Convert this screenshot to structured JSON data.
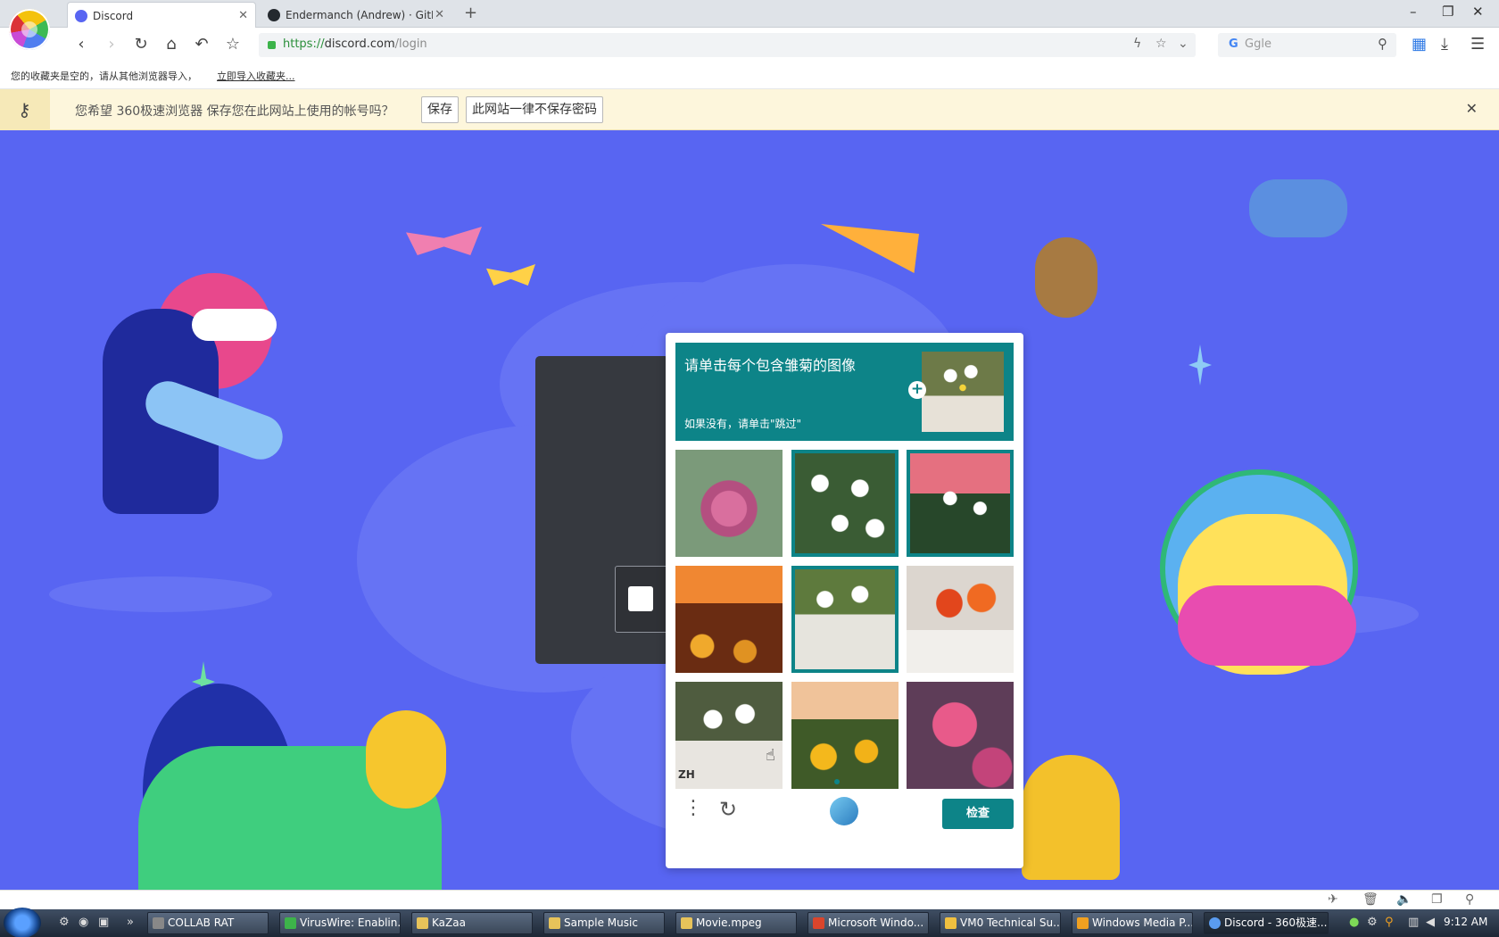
{
  "tabs": [
    {
      "title": "Discord",
      "active": true,
      "favicon_color": "#5865f2"
    },
    {
      "title": "Endermanch (Andrew) · GitHu",
      "active": false,
      "favicon_color": "#24292e"
    }
  ],
  "window_controls": {
    "minimize": "–",
    "restore": "❐",
    "close": "✕"
  },
  "nav": {
    "back_icon": "‹",
    "forward_icon": "›",
    "reload_icon": "↻",
    "home_icon": "⌂",
    "undo_icon": "↶",
    "favorite_icon": "☆"
  },
  "address": {
    "scheme": "https://",
    "host": "discord.com",
    "path": "/login"
  },
  "address_icons": {
    "lightning": "ϟ",
    "star": "☆",
    "dropdown": "⌄"
  },
  "search": {
    "engine": "G",
    "placeholder": "Ggle",
    "icon": "⚲"
  },
  "toolbar_icons": {
    "apps": "▦",
    "download": "⤓",
    "menu": "☰"
  },
  "bookmark_bar": {
    "message": "您的收藏夹是空的，请从其他浏览器导入，",
    "import_link": "立即导入收藏夹..."
  },
  "password_bar": {
    "key_icon": "🔑",
    "message": "您希望 360极速浏览器 保存您在此网站上使用的帐号吗？",
    "save_button": "保存",
    "never_button": "此网站一律不保存密码",
    "close_icon": "✕"
  },
  "captcha": {
    "title": "请单击每个包含雏菊的图像",
    "subtitle": "如果没有，请单击\"跳过\"",
    "plus_icon": "+",
    "tiles": [
      {
        "name": "rose",
        "selected": false
      },
      {
        "name": "daisy",
        "selected": true
      },
      {
        "name": "daisy-red",
        "selected": true
      },
      {
        "name": "sunset-sunflowers",
        "selected": false
      },
      {
        "name": "daisy-vase",
        "selected": true
      },
      {
        "name": "tulips",
        "selected": false
      },
      {
        "name": "daisy-vase-2",
        "selected": false
      },
      {
        "name": "sunflower-field",
        "selected": false
      },
      {
        "name": "peony",
        "selected": false
      }
    ],
    "language": "ZH",
    "menu_icon": "⋮",
    "refresh_icon": "↻",
    "check_button": "检查",
    "accent": "#0d8488"
  },
  "status_icons": [
    "✈",
    "🗑",
    "🔈",
    "❐",
    "⚲"
  ],
  "taskbar": {
    "items": [
      {
        "label": "COLLAB RAT",
        "color": "#888"
      },
      {
        "label": "VirusWire: Enablin...",
        "color": "#3db34a"
      },
      {
        "label": "KaZaa",
        "color": "#e7c35a"
      },
      {
        "label": "Sample Music",
        "color": "#e7c35a"
      },
      {
        "label": "Movie.mpeg",
        "color": "#e7c35a"
      },
      {
        "label": "Microsoft Windo...",
        "color": "#d9452c"
      },
      {
        "label": "VM0 Technical Su...",
        "color": "#f0c040"
      },
      {
        "label": "Windows Media P...",
        "color": "#f0a020"
      },
      {
        "label": "Discord - 360极速...",
        "color": "#5a9cf0"
      }
    ],
    "clock": "9:12 AM"
  }
}
